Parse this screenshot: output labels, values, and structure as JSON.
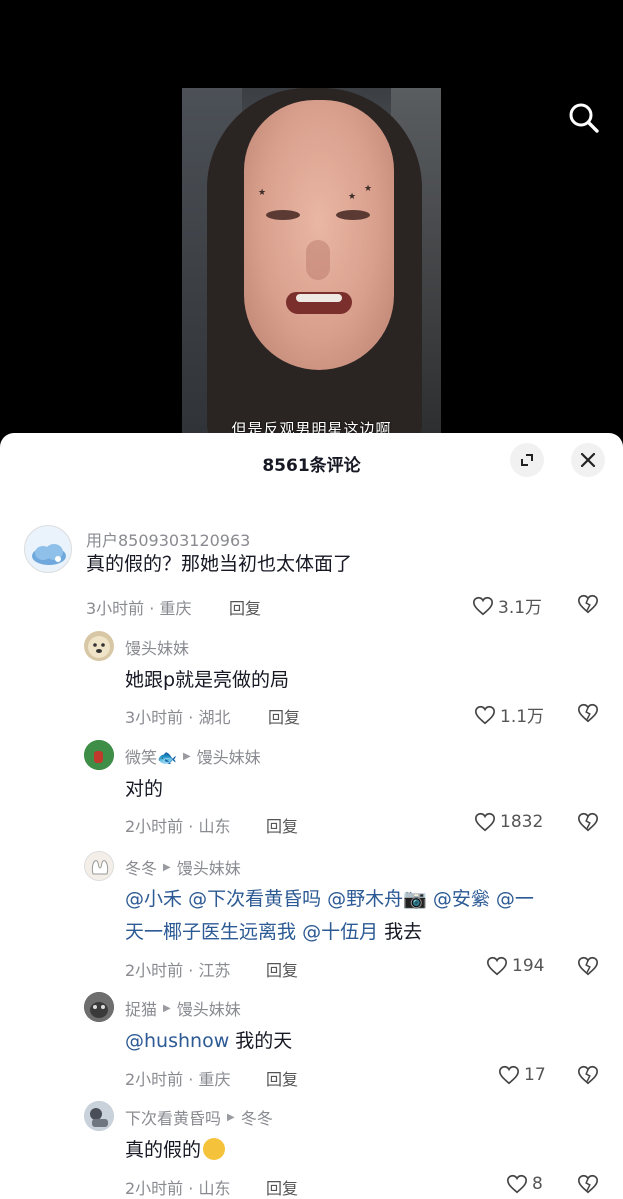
{
  "video": {
    "subtitle": "但是反观男明星这边啊"
  },
  "icons": {
    "search": "search-icon",
    "expand": "expand-icon",
    "close": "close-icon",
    "like": "heart-icon",
    "dislike": "broken-heart-icon"
  },
  "sheet": {
    "title": "8561条评论"
  },
  "comments": [
    {
      "user": "用户8509303120963",
      "text": "真的假的？那她当初也太体面了",
      "meta": "3小时前 · 重庆",
      "reply": "回复",
      "likes": "3.1万"
    },
    {
      "user": "馒头妹妹",
      "text": "她跟p就是亮做的局",
      "meta": "3小时前 · 湖北",
      "reply": "回复",
      "likes": "1.1万"
    },
    {
      "user": "微笑🐟",
      "reply_to": "馒头妹妹",
      "text": "对的",
      "meta": "2小时前 · 山东",
      "reply": "回复",
      "likes": "1832"
    },
    {
      "user": "冬冬",
      "reply_to": "馒头妹妹",
      "text_line1_mentions": [
        "@小禾",
        "@下次看黄昏吗",
        "@野木舟📷",
        "@安繠",
        "@一"
      ],
      "text_line2_mention": "天一椰子医生远离我",
      "text_line2_mention2": "@十伍月",
      "text_line2_suffix": "我去",
      "meta": "2小时前 · 江苏",
      "reply": "回复",
      "likes": "194"
    },
    {
      "user": "捉猫",
      "reply_to": "馒头妹妹",
      "mention": "@hushnow",
      "text": "我的天",
      "meta": "2小时前 · 重庆",
      "reply": "回复",
      "likes": "17"
    },
    {
      "user": "下次看黄昏吗",
      "reply_to": "冬冬",
      "text": "真的假的",
      "meta": "2小时前 · 山东",
      "reply": "回复",
      "likes": "8"
    }
  ]
}
